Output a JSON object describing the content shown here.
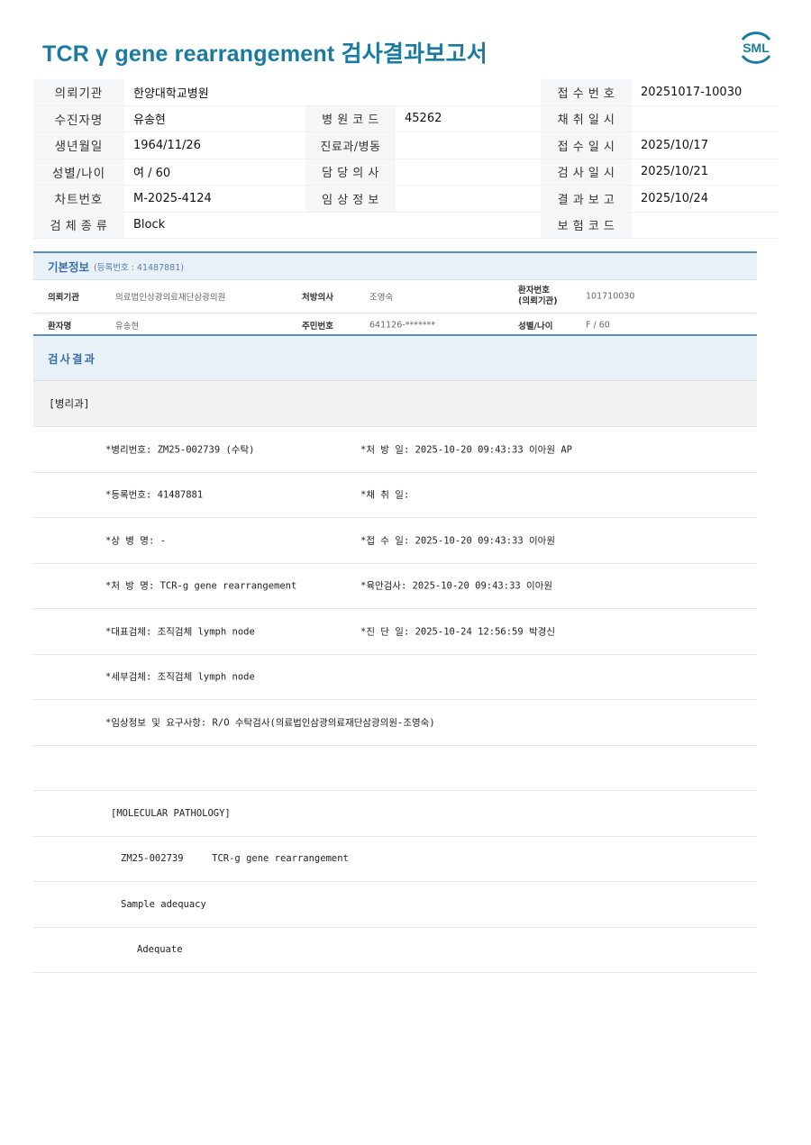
{
  "header": {
    "title": "TCR γ gene rearrangement 검사결과보고서",
    "logo_text": "SML",
    "logo_color": "#1a7aa0"
  },
  "patient_info": {
    "requesting_institution_label": "의뢰기관",
    "requesting_institution": "한양대학교병원",
    "reception_no_label": "접 수 번 호",
    "reception_no": "20251017-10030",
    "examinee_label": "수진자명",
    "examinee": "유송현",
    "hospital_code_label": "병 원 코 드",
    "hospital_code": "45262",
    "collection_date_label": "채 취 일 시",
    "collection_date": "",
    "birth_label": "생년월일",
    "birth": "1964/11/26",
    "dept_label": "진료과/병동",
    "dept": "",
    "reception_date_label": "접 수 일 시",
    "reception_date": "2025/10/17",
    "sex_age_label": "성별/나이",
    "sex_age": "여 / 60",
    "doctor_label": "담 당 의 사",
    "doctor": "",
    "exam_date_label": "검 사 일 시",
    "exam_date": "2025/10/21",
    "chart_no_label": "차트번호",
    "chart_no": "M-2025-4124",
    "clinical_label": "임 상 정 보",
    "clinical": "",
    "result_report_label": "결 과 보 고",
    "result_report": "2025/10/24",
    "specimen_label": "검 체 종 류",
    "specimen": "Block",
    "insurance_label": "보 험 코 드",
    "insurance": ""
  },
  "basic_info": {
    "title": "기본정보",
    "reg_no": "(등록번호 : 41487881)",
    "inst_label": "의뢰기관",
    "inst": "의료법인상광의료재단삼광의원",
    "prescriber_label": "처방의사",
    "prescriber": "조영숙",
    "patient_no_label1": "환자번호",
    "patient_no_label2": "(의뢰기관)",
    "patient_no": "101710030",
    "patient_name_label": "환자명",
    "patient_name": "유송현",
    "rrn_label": "주민번호",
    "rrn": "641126-*******",
    "sex_age_label": "성별/나이",
    "sex_age": "F / 60"
  },
  "result": {
    "title": "검사결과",
    "department": "[병리과]",
    "rows": [
      {
        "left": "*병리번호: ZM25-002739 (수탁)",
        "right": "*처 방 일: 2025-10-20 09:43:33  이아원 AP"
      },
      {
        "left": "*등록번호: 41487881",
        "right": "*채 취 일:"
      },
      {
        "left": "*상 병 명: -",
        "right": "*접 수 일: 2025-10-20 09:43:33  이아원"
      },
      {
        "left": "*처 방 명: TCR-g gene rearrangement",
        "right": "*육안검사: 2025-10-20 09:43:33  이아원"
      },
      {
        "left": "*대표검체: 조직검체 lymph node",
        "right": "*진 단 일: 2025-10-24 12:56:59  박경신"
      },
      {
        "left": "*세부검체: 조직검체 lymph node",
        "right": ""
      },
      {
        "left": "*임상정보 및 요구사항: R/O 수탁검사(의료법인삼광의료재단삼광의원-조영숙)",
        "right": ""
      },
      {
        "left": "",
        "right": ""
      }
    ],
    "mol_header": "[MOLECULAR PATHOLOGY]",
    "mol_line1": "ZM25-002739     TCR-g gene rearrangement",
    "mol_line2": "Sample adequacy",
    "mol_line3": "Adequate"
  }
}
